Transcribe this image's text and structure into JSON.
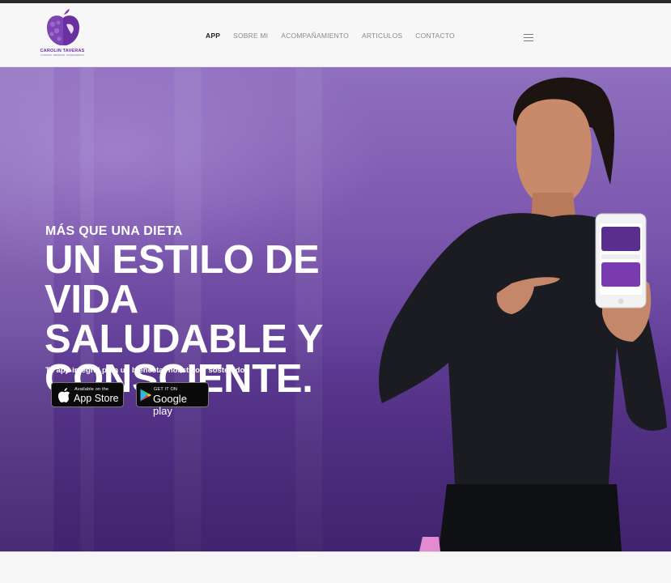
{
  "brand": {
    "name": "CAROLIN TAVERAS",
    "subtitle": "NUTRICIÓN · BIENESTAR · ENTRENAMIENTO"
  },
  "nav": {
    "items": [
      {
        "label": "APP",
        "active": true
      },
      {
        "label": "SOBRE MI",
        "active": false
      },
      {
        "label": "ACOMPAÑAMIENTO",
        "active": false
      },
      {
        "label": "ARTICULOS",
        "active": false
      },
      {
        "label": "CONTACTO",
        "active": false
      }
    ],
    "menu_icon": "hamburger-icon"
  },
  "hero": {
    "eyebrow": "MÁS QUE UNA DIETA",
    "headline_lines": [
      "UN ESTILO DE VIDA",
      "SALUDABLE Y",
      "CONSCIENTE."
    ],
    "tagline": "Tu app integral para un bienestar holístico y sostenido."
  },
  "stores": {
    "appstore": {
      "small": "Available on the",
      "big": "App Store",
      "icon": "apple-icon"
    },
    "googleplay": {
      "small": "GET IT ON",
      "big": "Google play",
      "icon": "google-play-icon"
    }
  },
  "colors": {
    "brand_purple": "#6a2fa0",
    "hero_purple": "#6a48a2"
  }
}
